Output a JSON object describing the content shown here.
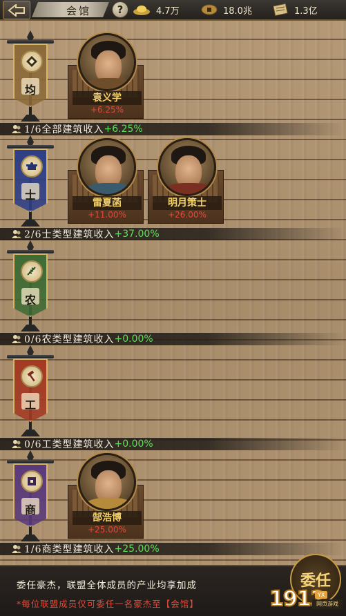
{
  "header": {
    "title": "会馆",
    "help_label": "?",
    "resources": [
      {
        "name": "silver",
        "icon": "silver-ingot-icon",
        "value": "4.7万"
      },
      {
        "name": "coin",
        "icon": "coin-icon",
        "value": "18.0兆"
      },
      {
        "name": "scroll",
        "icon": "scroll-icon",
        "value": "1.3亿"
      }
    ]
  },
  "sections": [
    {
      "key": "all",
      "banner_char": "均",
      "banner_color": "#8c6a3a",
      "emblem": "diamond-emblem-icon",
      "bar_text": "1/6全部建筑收入",
      "bar_pct": "+6.25%",
      "heroes": [
        {
          "name": "袁义学",
          "pct": "+6.25%",
          "robe": "#6e4d2a"
        }
      ]
    },
    {
      "key": "scholar",
      "banner_char": "士",
      "banner_color": "#2e3f86",
      "emblem": "scholar-hat-emblem-icon",
      "bar_text": "2/6士类型建筑收入",
      "bar_pct": "+37.00%",
      "heroes": [
        {
          "name": "雷夏菡",
          "pct": "+11.00%",
          "robe": "#3a5a6e"
        },
        {
          "name": "明月策士",
          "pct": "+26.00%",
          "robe": "#7a2f22"
        }
      ]
    },
    {
      "key": "farm",
      "banner_char": "农",
      "banner_color": "#3f6b34",
      "emblem": "wheat-emblem-icon",
      "bar_text": "0/6农类型建筑收入",
      "bar_pct": "+0.00%",
      "heroes": []
    },
    {
      "key": "craft",
      "banner_char": "工",
      "banner_color": "#a33a24",
      "emblem": "hammer-emblem-icon",
      "bar_text": "0/6工类型建筑收入",
      "bar_pct": "+0.00%",
      "heroes": []
    },
    {
      "key": "trade",
      "banner_char": "商",
      "banner_color": "#5a3a7a",
      "emblem": "coin-emblem-icon",
      "bar_text": "1/6商类型建筑收入",
      "bar_pct": "+25.00%",
      "heroes": [
        {
          "name": "郜浩博",
          "pct": "+25.00%",
          "robe": "#b58a3a"
        }
      ]
    }
  ],
  "footer": {
    "line1": "委任豪杰，联盟全体成员的产业均享加成",
    "line2": "*每位联盟成员仅可委任一名豪杰至【会馆】",
    "appoint_label": "委任"
  },
  "watermark": {
    "number": "1912",
    "yx": "YX",
    "sub": "网页游戏"
  }
}
